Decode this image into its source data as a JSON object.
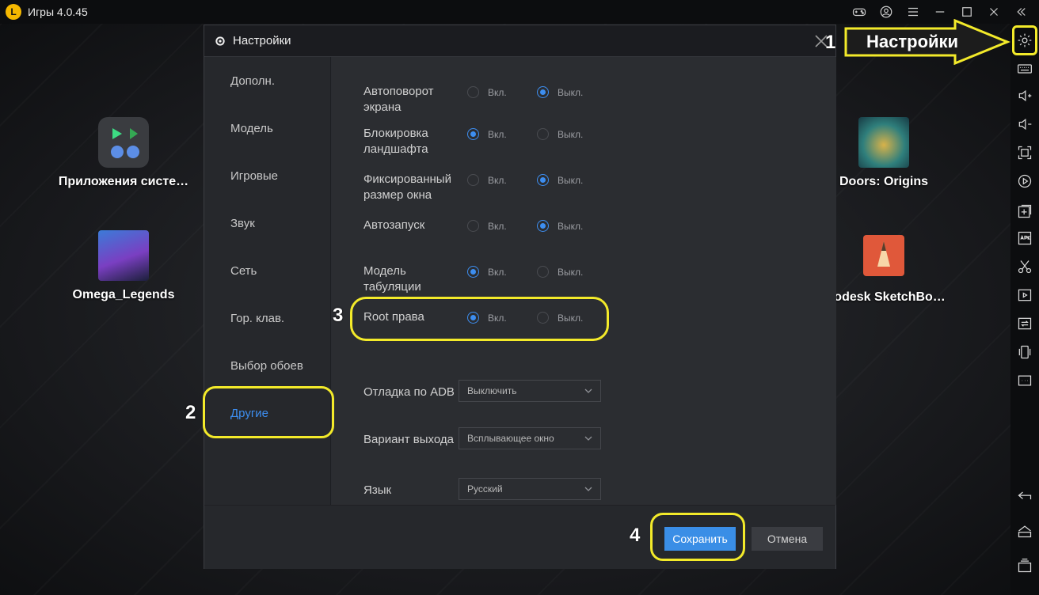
{
  "titlebar": {
    "title": "Игры 4.0.45",
    "icons": [
      "gamepad-icon",
      "account-icon",
      "menu-icon",
      "minimize-icon",
      "maximize-icon",
      "close-icon",
      "collapse-icon"
    ]
  },
  "desktop": {
    "icons": [
      {
        "name": "system-apps",
        "label": "Приложения систе…"
      },
      {
        "name": "omega-legends",
        "label": "Omega_Legends"
      },
      {
        "name": "doors-origins",
        "label": "Doors: Origins"
      },
      {
        "name": "autodesk-sketchbook",
        "label": "utodesk SketchBo…"
      }
    ]
  },
  "sidebar": {
    "icons": [
      "settings-icon",
      "keyboard-icon",
      "volume-up-icon",
      "volume-down-icon",
      "fullscreen-icon",
      "record-icon",
      "add-window-icon",
      "apk-icon",
      "cut-icon",
      "media-icon",
      "sync-icon",
      "shake-icon",
      "more-icon",
      "back-icon",
      "home-icon",
      "recent-apps-icon"
    ]
  },
  "dialog": {
    "title": "Настройки",
    "nav": [
      {
        "label": "Дополн."
      },
      {
        "label": "Модель"
      },
      {
        "label": "Игровые"
      },
      {
        "label": "Звук"
      },
      {
        "label": "Сеть"
      },
      {
        "label": "Гор. клав."
      },
      {
        "label": "Выбор обоев"
      },
      {
        "label": "Другие"
      }
    ],
    "active_nav": "Другие",
    "radio_on": "Вкл.",
    "radio_off": "Выкл.",
    "options": [
      {
        "label": "Автоповорот экрана",
        "line1": "Автоповорот",
        "line2": "экрана",
        "value": "off"
      },
      {
        "label": "Блокировка ландшафта",
        "line1": "Блокировка",
        "line2": "ландшафта",
        "value": "on"
      },
      {
        "label": "Фиксированный размер окна",
        "line1": "Фиксированный",
        "line2": "размер окна",
        "value": "off"
      },
      {
        "label": "Автозапуск",
        "line1": "Автозапуск",
        "line2": "",
        "value": "off"
      },
      {
        "label": "Модель табуляции",
        "line1": "Модель",
        "line2": "табуляции",
        "value": "on"
      },
      {
        "label": "Root права",
        "line1": "Root права",
        "line2": "",
        "value": "on"
      }
    ],
    "selects": [
      {
        "label": "Отладка по ADB",
        "value": "Выключить"
      },
      {
        "label": "Вариант выхода",
        "value": "Всплывающее окно"
      },
      {
        "label": "Язык",
        "value": "Русский"
      }
    ],
    "save_label": "Сохранить",
    "cancel_label": "Отмена"
  },
  "annotations": {
    "callout_text": "Настройки",
    "step1": "1",
    "step2": "2",
    "step3": "3",
    "step4": "4",
    "highlight_color": "#f3ea2a"
  },
  "colors": {
    "accent": "#3d8ef0",
    "save_button": "#3a8ee6"
  }
}
